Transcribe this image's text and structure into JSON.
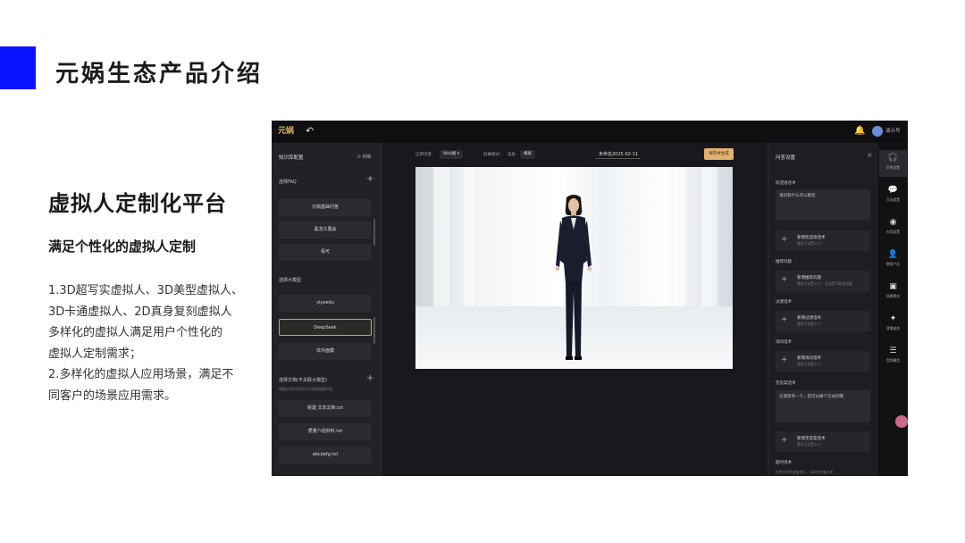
{
  "slide": {
    "title": "元娲生态产品介绍",
    "heading": "虚拟人定制化平台",
    "subheading": "满足个性化的虚拟人定制",
    "desc_lines": [
      "1.3D超写实虚拟人、3D美型虚拟人、",
      "3D卡通虚拟人、2D真身复刻虚拟人",
      "多样化的虚拟人满足用户个性化的",
      "虚拟人定制需求；",
      "2.多样化的虚拟人应用场景，满足不",
      "同客户的场景应用需求。"
    ],
    "accent_color": "#0a13ff"
  },
  "app": {
    "logo": "元娲",
    "back_icon": "undo-icon",
    "user_name": "演示号",
    "kb": {
      "title": "知识库配置",
      "refresh": "刷新",
      "faq_section": "选择FAQ",
      "faq_items": [
        "元娲基础问答",
        "黑龙江展会",
        "看可"
      ],
      "model_section": "选择大模型",
      "model_items": [
        "yiyoedu",
        "DeepSeek",
        "非外面膜"
      ],
      "doc_section": "选择文档(不关联大模型)",
      "doc_hint": "根据文档内容进行问答或答疑问答",
      "doc_items": [
        "新建 文本文档.txt",
        "质量介绍材料.txt",
        "abcdefg.txt"
      ]
    },
    "toolbar": {
      "scene_label": "应用场景：",
      "scene_value": "Web端",
      "display_label": "屏幕模式：",
      "display_value1": "竖屏",
      "display_value2": "横屏",
      "name_value": "未命名2025-02-11",
      "save_label": "保存并生成"
    },
    "qa": {
      "title": "问答设置",
      "welcome_section": "欢迎语话术",
      "welcome_text": "请问有什么可以看您",
      "add_welcome": "新增欢迎语话术",
      "add_hint": "最多可设置10个",
      "recommend_section": "推荐问题",
      "add_recommend": "新增推荐问题",
      "recommend_hint": "最多可设置10个，若设置问题请加重",
      "transition_section": "过渡话术",
      "add_transition": "新增过渡话术",
      "fallback_section": "询问话术",
      "add_fallback": "新增询问话术",
      "noanswer_section": "无答案话术",
      "noanswer_text": "让我思考一下，您可以换个方式问哦",
      "add_noanswer": "新增无答案话术",
      "timeout_section": "超时话术",
      "timeout_hint": "在时间内的答复提示，如未有答复话术"
    },
    "rail": [
      {
        "icon": "headset-icon",
        "glyph": "🎧",
        "label": "问答设置"
      },
      {
        "icon": "chat-icon",
        "glyph": "💬",
        "label": "互动设置"
      },
      {
        "icon": "globe-icon",
        "glyph": "◉",
        "label": "应用设置"
      },
      {
        "icon": "person-icon",
        "glyph": "👤",
        "label": "数智产品"
      },
      {
        "icon": "image-icon",
        "glyph": "▣",
        "label": "场景素材"
      },
      {
        "icon": "pose-icon",
        "glyph": "✦",
        "label": "背景姿态"
      },
      {
        "icon": "equalizer-icon",
        "glyph": "☰",
        "label": "音频模型"
      }
    ]
  }
}
